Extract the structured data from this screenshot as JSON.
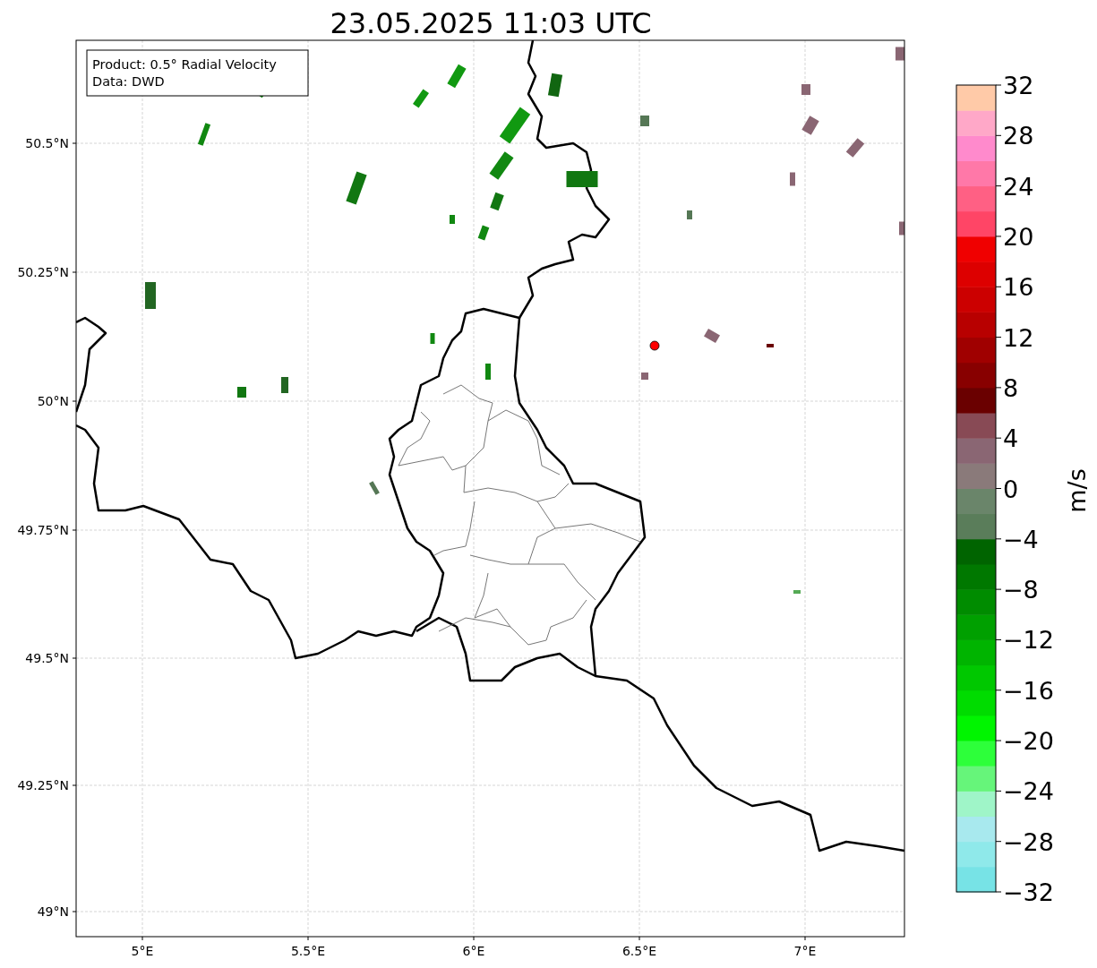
{
  "title": "23.05.2025 11:03 UTC",
  "info_box": {
    "lines": [
      "Product: 0.5° Radial Velocity",
      "Data: DWD"
    ]
  },
  "map": {
    "yticks": [
      "50.5°N",
      "50.25°N",
      "50°N",
      "49.75°N",
      "49.5°N",
      "49.25°N",
      "49°N"
    ],
    "xticks": [
      "5°E",
      "5.5°E",
      "6°E",
      "6.5°E",
      "7°E"
    ]
  },
  "colorbar": {
    "label": "m/s",
    "ticks": [
      "32",
      "28",
      "24",
      "20",
      "16",
      "12",
      "8",
      "4",
      "0",
      "−4",
      "−8",
      "−12",
      "−16",
      "−20",
      "−24",
      "−28",
      "−32"
    ],
    "bins": [
      {
        "color": "#77e3e6"
      },
      {
        "color": "#8fe9ea"
      },
      {
        "color": "#a8e9ee"
      },
      {
        "color": "#9ff5c8"
      },
      {
        "color": "#66f57a"
      },
      {
        "color": "#2dff3a"
      },
      {
        "color": "#00f500"
      },
      {
        "color": "#00dc00"
      },
      {
        "color": "#00c800"
      },
      {
        "color": "#00b400"
      },
      {
        "color": "#00a000"
      },
      {
        "color": "#008c00"
      },
      {
        "color": "#007800"
      },
      {
        "color": "#006400"
      },
      {
        "color": "#5a7d5a"
      },
      {
        "color": "#6a856a"
      },
      {
        "color": "#8a7a7a"
      },
      {
        "color": "#8a6673"
      },
      {
        "color": "#884a55"
      },
      {
        "color": "#6a0000"
      },
      {
        "color": "#880000"
      },
      {
        "color": "#a00000"
      },
      {
        "color": "#b80000"
      },
      {
        "color": "#cc0000"
      },
      {
        "color": "#dd0000"
      },
      {
        "color": "#f00000"
      },
      {
        "color": "#ff4566"
      },
      {
        "color": "#ff6084"
      },
      {
        "color": "#ff78a8"
      },
      {
        "color": "#ff8acc"
      },
      {
        "color": "#ffa8c8"
      },
      {
        "color": "#ffcaa8"
      }
    ]
  }
}
